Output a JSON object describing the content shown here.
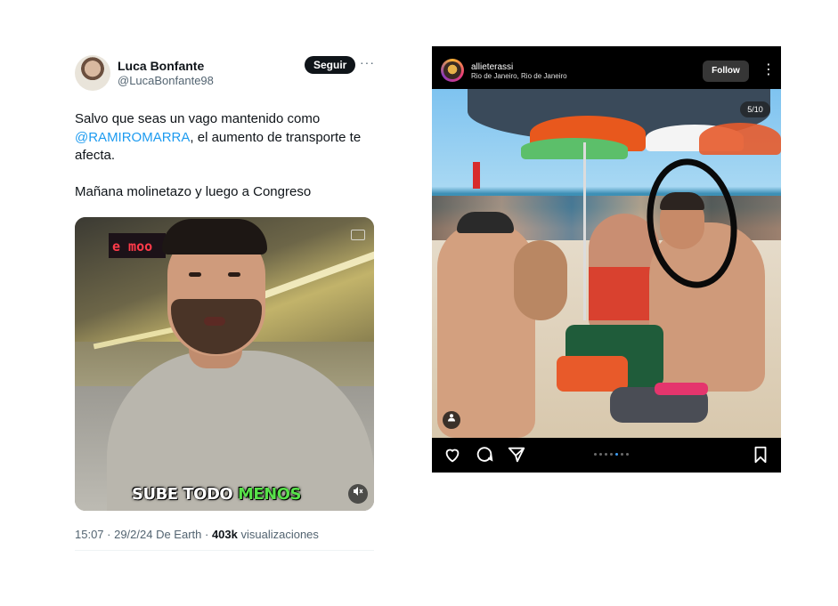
{
  "tweet": {
    "author_name": "Luca Bonfante",
    "handle": "@LucaBonfante98",
    "follow_label": "Seguir",
    "more_label": "···",
    "text_pre": "Salvo que seas un vago mantenido como ",
    "mention": "@RAMIROMARRA",
    "text_post": ", el aumento de transporte te afecta.",
    "text_2": "Mañana molinetazo y luego a Congreso",
    "video": {
      "sign_text": "e moo",
      "caption_white": "SUBE TODO ",
      "caption_green": "MENOS",
      "mute_icon": "mute-icon"
    },
    "meta_prefix": "15:07 · 29/2/24 De Earth · ",
    "views_count": "403k",
    "views_label": " visualizaciones"
  },
  "instagram": {
    "username": "allieterassi",
    "location": "Rio de Janeiro, Rio de Janeiro",
    "follow_label": "Follow",
    "more_label": "⋮",
    "counter": "5/10",
    "carousel_dots": 7,
    "carousel_active_dot": 5,
    "icons": [
      "heart-icon",
      "comment-icon",
      "share-icon",
      "bookmark-icon",
      "user-tag-icon"
    ],
    "accent_color": "#3d9df6"
  }
}
